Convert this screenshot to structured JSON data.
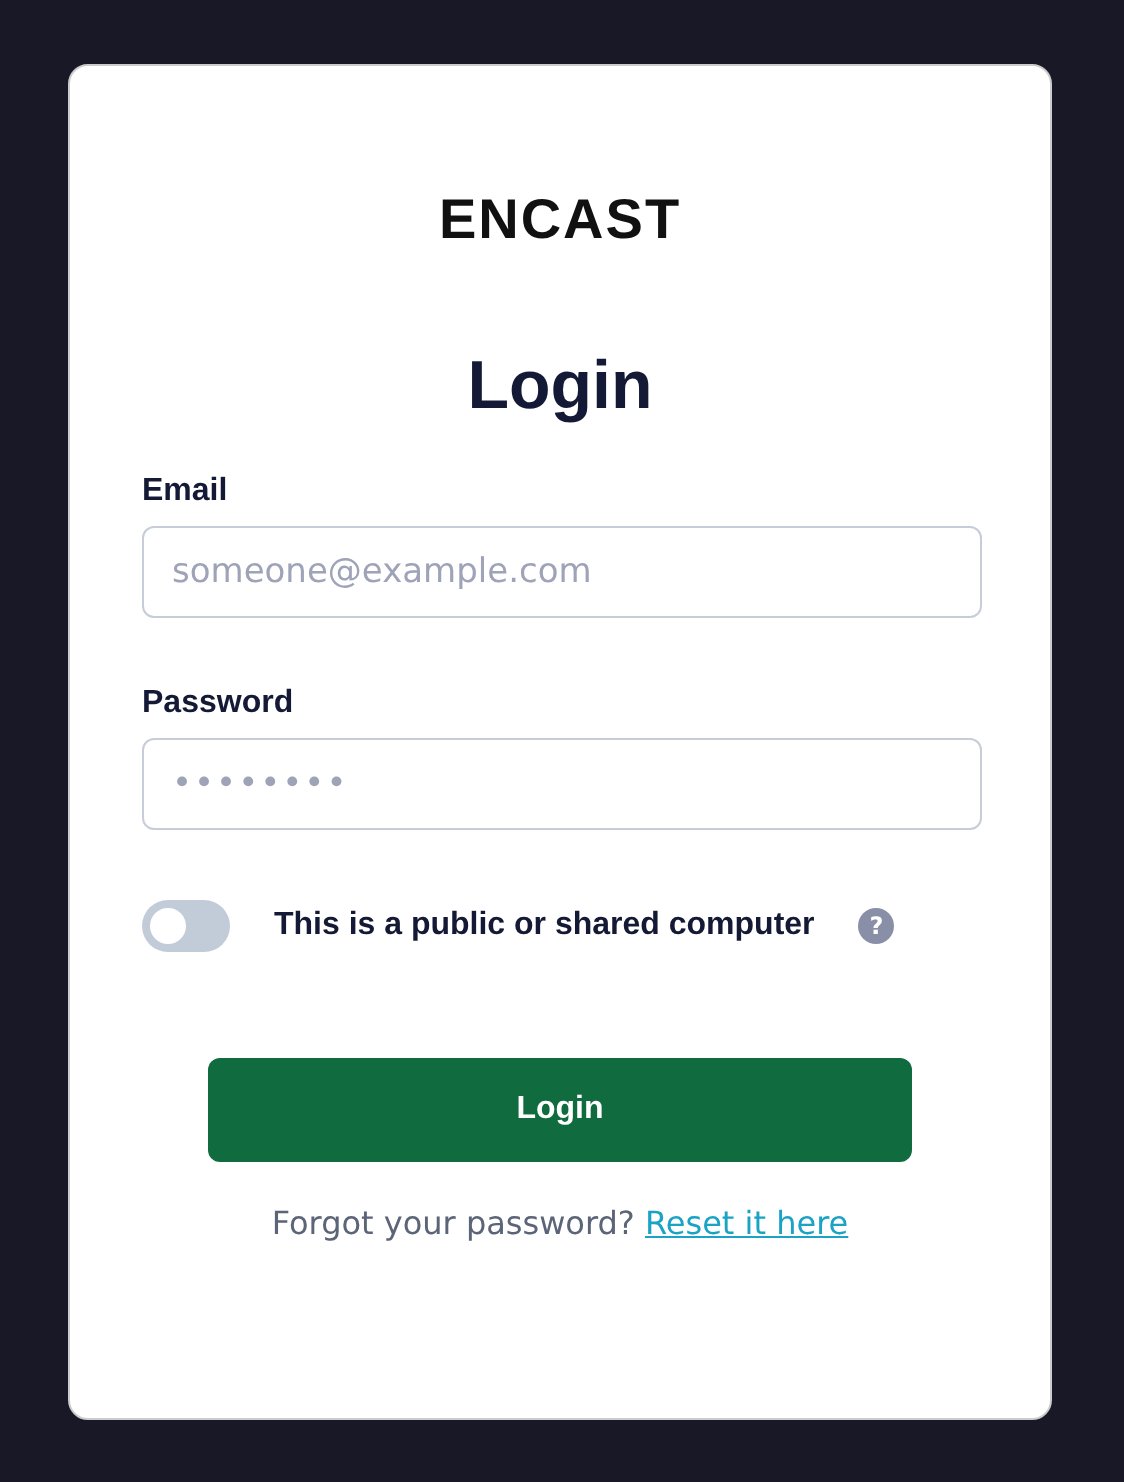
{
  "logo": "ENCAST",
  "title": "Login",
  "fields": [
    {
      "label": "Email",
      "placeholder": "someone@example.com"
    },
    {
      "label": "Password",
      "value": "••••••••"
    }
  ],
  "toggle": {
    "label": "This is a public or shared computer",
    "on": false,
    "help": "?"
  },
  "button": "Login",
  "footer": {
    "text": "Forgot your password?",
    "link": "Reset it here"
  }
}
